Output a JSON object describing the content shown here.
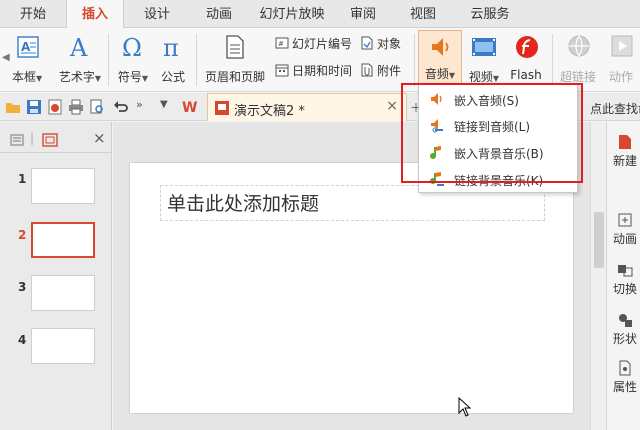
{
  "tabs": [
    "开始",
    "插入",
    "设计",
    "动画",
    "幻灯片放映",
    "审阅",
    "视图",
    "云服务"
  ],
  "active_tab": "插入",
  "ribbon": {
    "textbox_label": "本框",
    "wordart_label": "艺术字",
    "symbol_label": "符号",
    "formula_label": "公式",
    "header_footer_label": "页眉和页脚",
    "slide_number_label": "幻灯片编号",
    "object_label": "对象",
    "datetime_label": "日期和时间",
    "attachment_label": "附件",
    "audio_label": "音频",
    "video_label": "视频",
    "flash_label": "Flash",
    "hyperlink_label": "超链接",
    "action_label": "动作"
  },
  "document": {
    "tab_title": "演示文稿2 *",
    "find_command": "点此查找命令"
  },
  "slides": [
    {
      "number": "1"
    },
    {
      "number": "2"
    },
    {
      "number": "3"
    },
    {
      "number": "4"
    }
  ],
  "active_slide": "2",
  "main_slide": {
    "title_placeholder": "单击此处添加标题"
  },
  "right_pane": {
    "items": [
      "新建",
      "动画",
      "切换",
      "形状",
      "属性"
    ]
  },
  "audio_menu": {
    "items": [
      "嵌入音频(S)",
      "链接到音频(L)",
      "嵌入背景音乐(B)",
      "链接背景音乐(K)"
    ]
  },
  "colors": {
    "accent": "#d6492f",
    "highlight_box": "#e02020"
  }
}
